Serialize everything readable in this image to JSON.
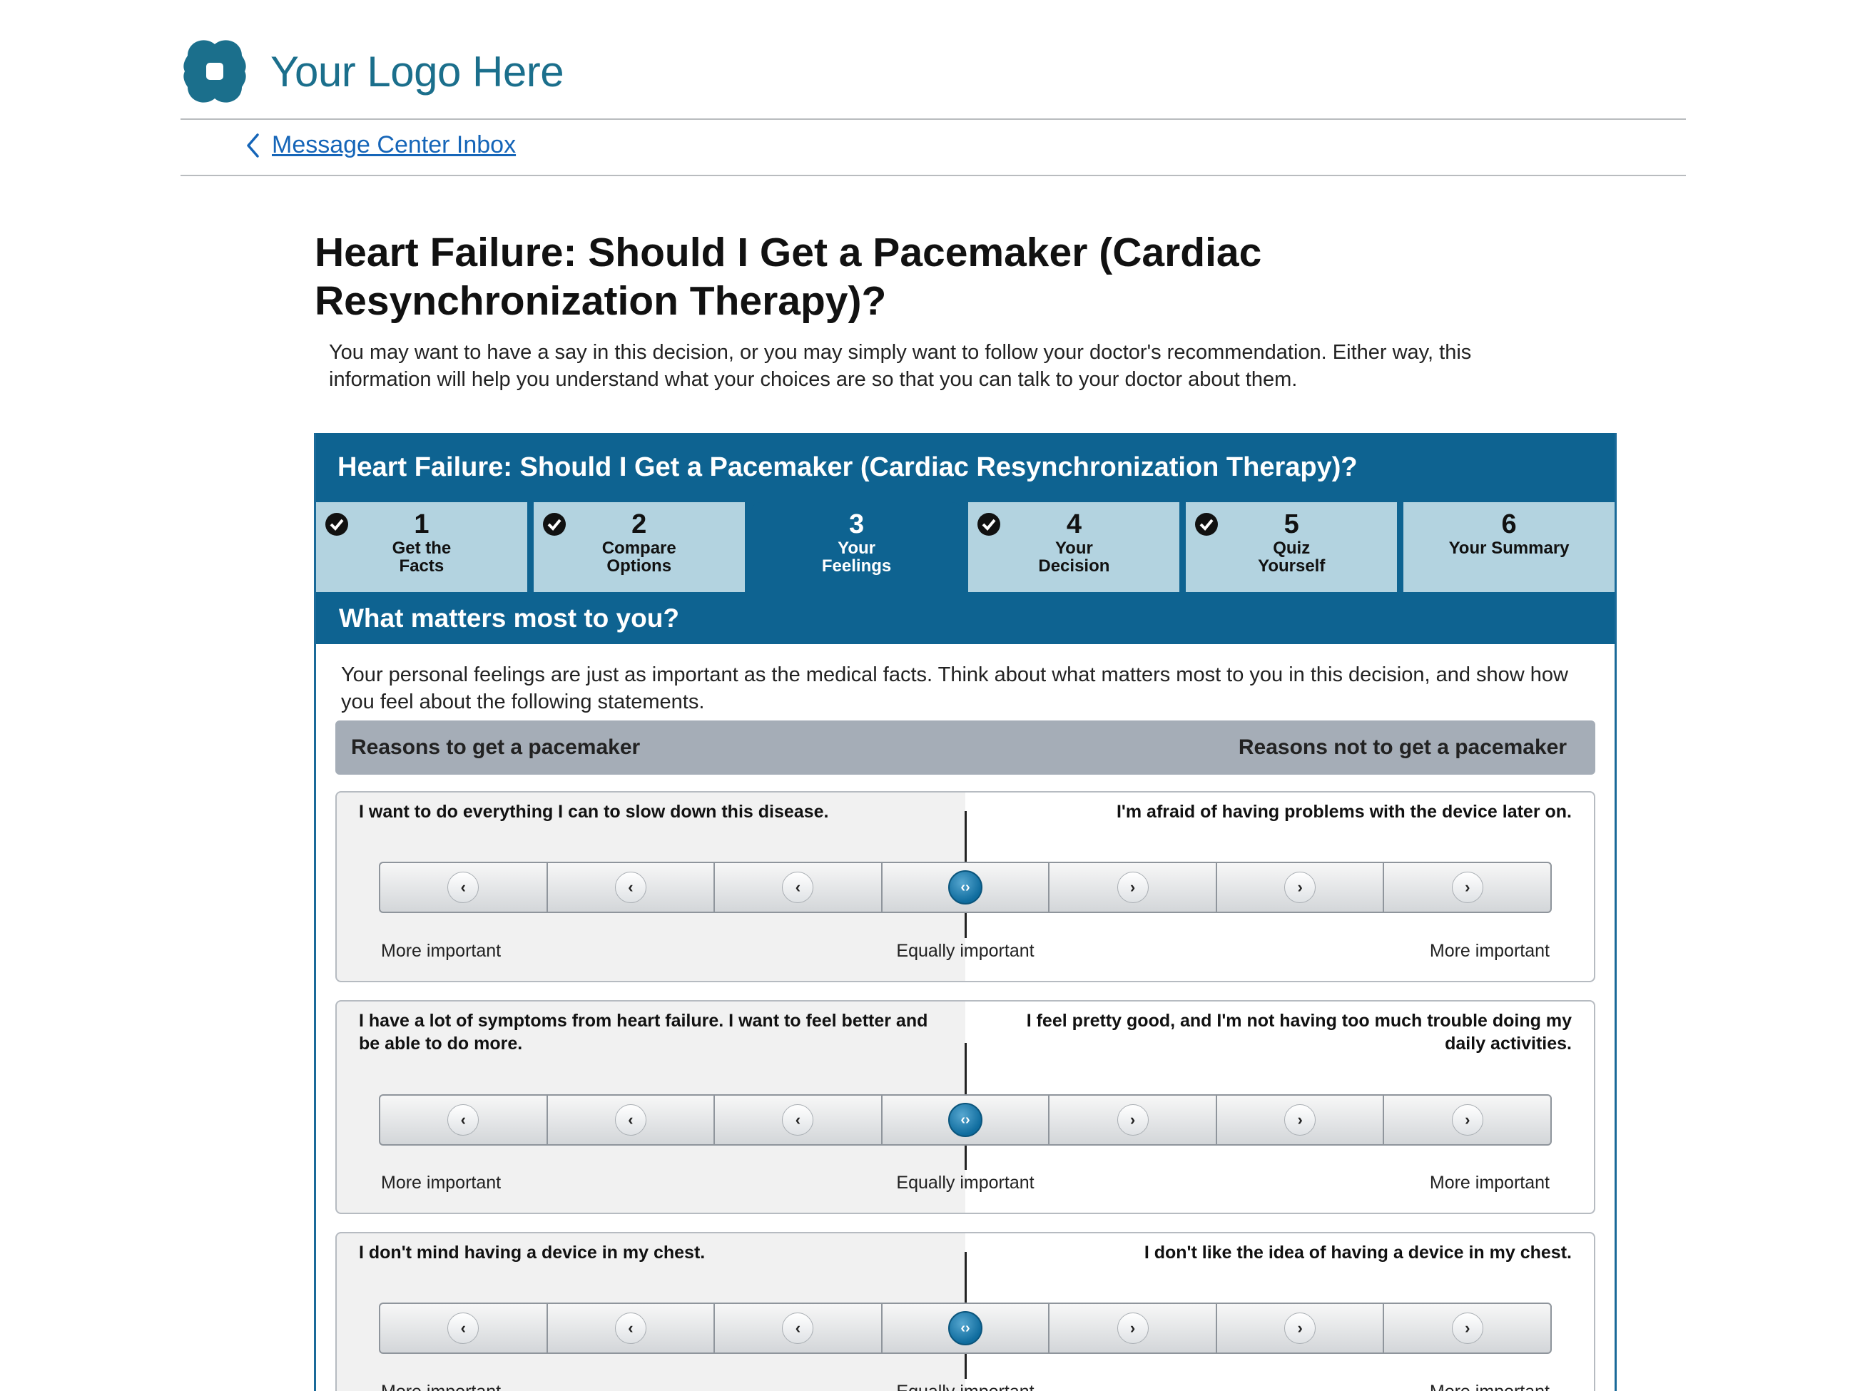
{
  "header": {
    "logo_text": "Your Logo Here",
    "back_link": "Message Center Inbox"
  },
  "page": {
    "title": "Heart Failure: Should I Get a Pacemaker (Cardiac Resynchronization Therapy)?",
    "intro": "You may want to have a say in this decision, or you may simply want to follow your doctor's recommendation. Either way, this information will help you understand what your choices are so that you can talk to your doctor about them."
  },
  "tool": {
    "title": "Heart Failure: Should I Get a Pacemaker (Cardiac Resynchronization Therapy)?",
    "steps": [
      {
        "num": "1",
        "label": "Get the Facts",
        "done": true
      },
      {
        "num": "2",
        "label": "Compare Options",
        "done": true
      },
      {
        "num": "3",
        "label": "Your Feelings",
        "done": false,
        "active": true
      },
      {
        "num": "4",
        "label": "Your Decision",
        "done": true
      },
      {
        "num": "5",
        "label": "Quiz Yourself",
        "done": true
      },
      {
        "num": "6",
        "label": "Your Summary",
        "done": false
      }
    ],
    "section_title": "What matters most to you?",
    "lead": "Your personal feelings are just as important as the medical facts. Think about what matters most to you in this decision, and show how you feel about the following statements.",
    "reasons_left": "Reasons to get a pacemaker",
    "reasons_right": "Reasons not to get a pacemaker",
    "scale": {
      "left": "More important",
      "center": "Equally important",
      "right": "More important"
    },
    "statements": [
      {
        "left": "I want to do everything I can to slow down this disease.",
        "right": "I'm afraid of having problems with the device later on.",
        "position": 0
      },
      {
        "left": "I have a lot of symptoms from heart failure. I want to feel better and be able to do more.",
        "right": "I feel pretty good, and I'm not having too much trouble doing my daily activities.",
        "position": 0
      },
      {
        "left": "I don't mind having a device in my chest.",
        "right": "I don't like the idea of having a device in my chest.",
        "position": 0
      }
    ],
    "colors": {
      "primary": "#0e6391",
      "tab_inactive": "#b3d3e0",
      "reasons_bar": "#a5adb7",
      "logo": "#1b6f8c",
      "link": "#1565b8"
    }
  }
}
